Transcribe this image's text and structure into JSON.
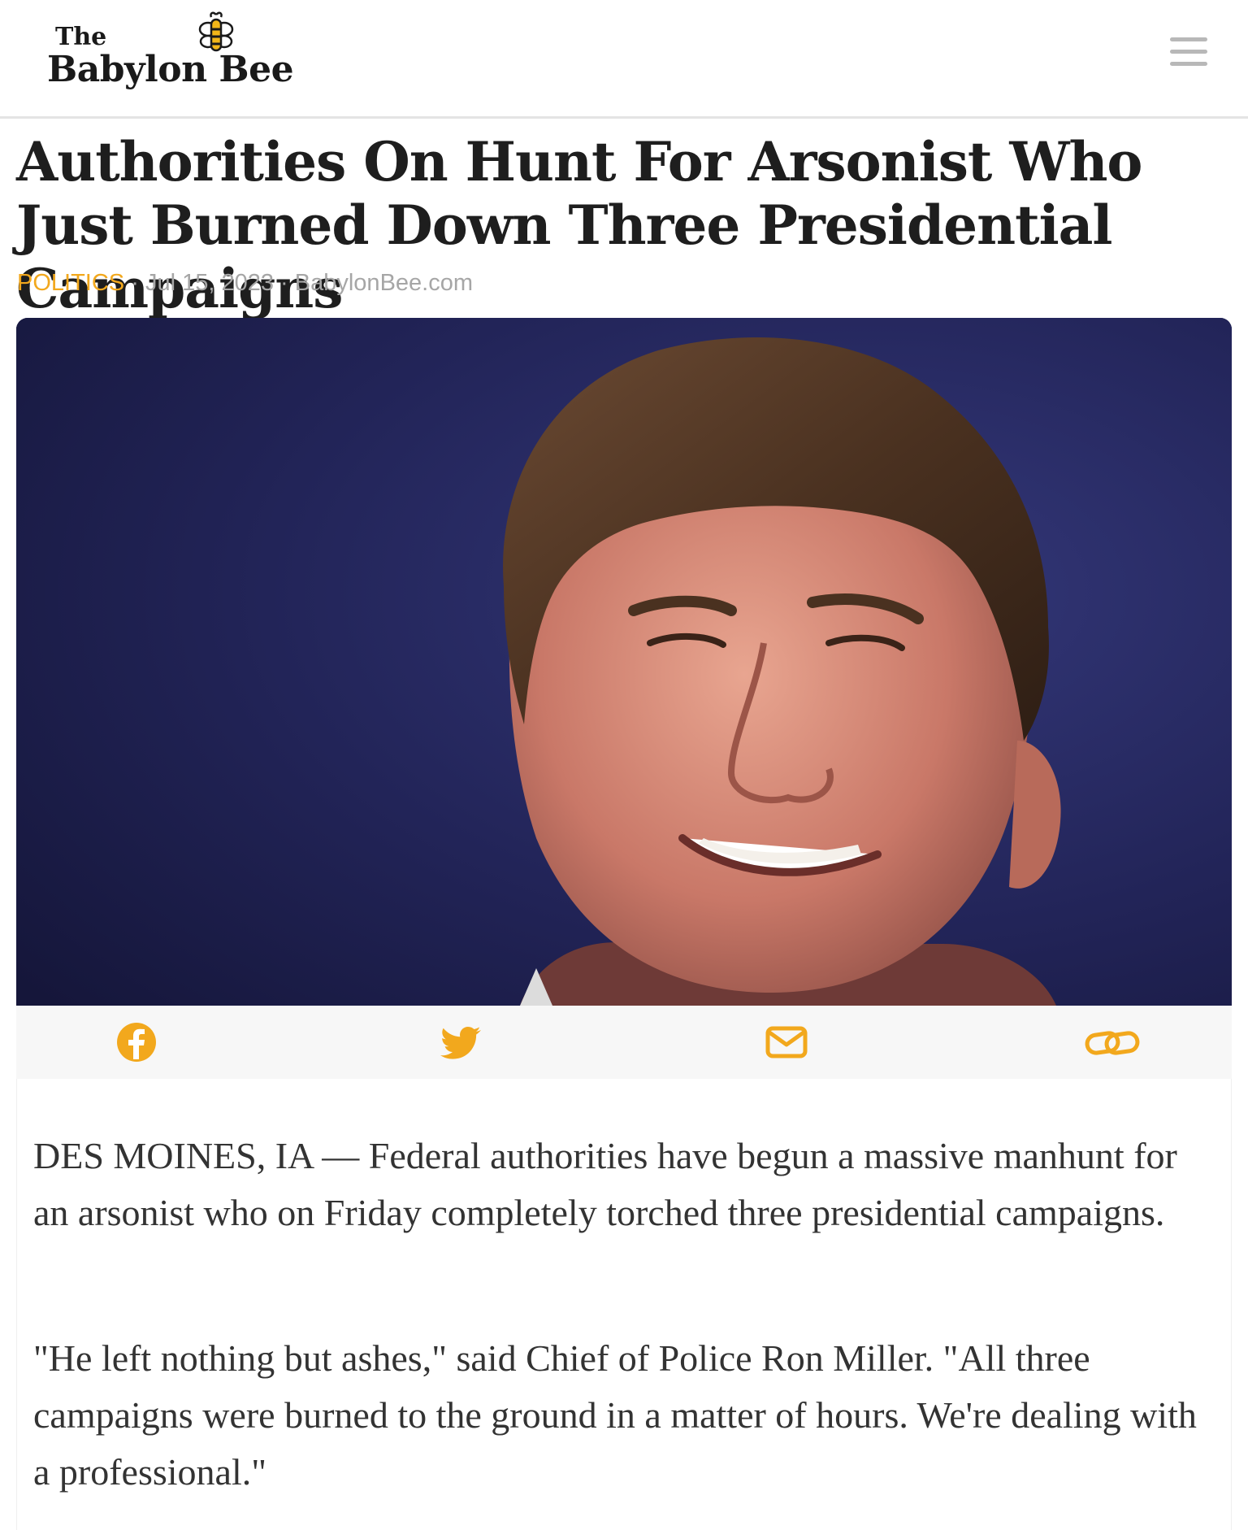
{
  "site": {
    "logo_the": "The",
    "logo_name": "Babylon Bee",
    "logo_icon": "bee-icon",
    "menu_icon": "hamburger-menu-icon"
  },
  "article": {
    "title": "Authorities On Hunt For Arsonist Who Just Burned Down Three Presidential Campaigns",
    "category": "POLITICS",
    "separator": "·",
    "date": "Jul 15, 2023",
    "source": "BabylonBee.com",
    "paragraphs": [
      "DES MOINES, IA — Federal authorities have begun a massive manhunt for an arsonist who on Friday completely torched three presidential campaigns.",
      "\"He left nothing but ashes,\" said Chief of Police Ron Miller. \"All three campaigns were burned to the ground in a matter of hours. We're dealing with a professional.\""
    ]
  },
  "share": {
    "items": [
      {
        "name": "facebook",
        "icon": "facebook-icon"
      },
      {
        "name": "twitter",
        "icon": "twitter-icon"
      },
      {
        "name": "email",
        "icon": "envelope-icon"
      },
      {
        "name": "copy-link",
        "icon": "link-icon"
      }
    ]
  },
  "colors": {
    "accent": "#f2a81d",
    "meta": "#a6a6a6",
    "title": "#1e1e1e",
    "body_text": "#333333",
    "hero_background": "#1c1d4a"
  }
}
